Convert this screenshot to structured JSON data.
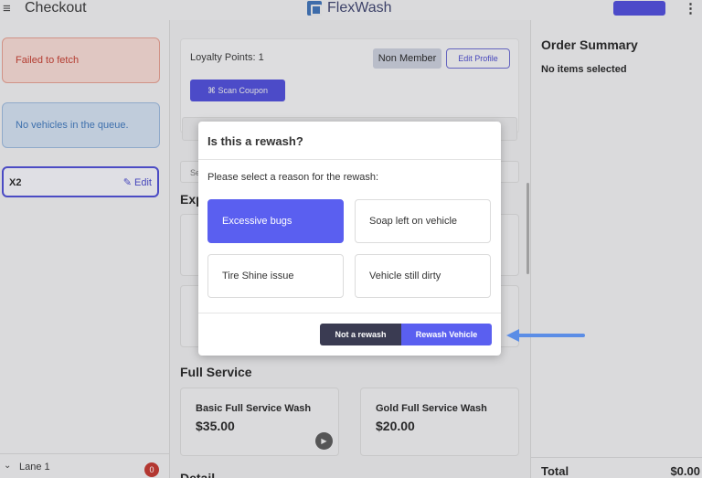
{
  "header": {
    "title": "Checkout",
    "brand": "FlexWash",
    "menu_glyph": "≡",
    "more_glyph": "⋮"
  },
  "left": {
    "error_text": "Failed to fetch",
    "info_text": "No vehicles in the queue.",
    "vehicle_label": "X2",
    "vehicle_edit": "✎ Edit",
    "lane_label": "Lane 1",
    "lane_count": "0"
  },
  "middle": {
    "loyalty_text": "Loyalty Points: 1",
    "member_badge": "Non Member",
    "edit_profile": "Edit Profile",
    "scan_coupon": "⌘  Scan Coupon",
    "search_stub": "Se",
    "section_exp": "Exp",
    "section_full": "Full Service",
    "section_details": "Detail",
    "wash_cards": [
      {
        "name": "Basic Full Service Wash",
        "price": "$35.00"
      },
      {
        "name": "Gold Full Service Wash",
        "price": "$20.00"
      }
    ]
  },
  "right": {
    "order_title": "Order Summary",
    "order_empty": "No items selected",
    "total_label": "Total",
    "total_value": "$0.00"
  },
  "modal": {
    "title": "Is this a rewash?",
    "prompt": "Please select a reason for the rewash:",
    "reasons": [
      {
        "label": "Excessive bugs",
        "selected": true
      },
      {
        "label": "Soap left on vehicle",
        "selected": false
      },
      {
        "label": "Tire Shine issue",
        "selected": false
      },
      {
        "label": "Vehicle still dirty",
        "selected": false
      }
    ],
    "not_rewash_label": "Not a rewash",
    "rewash_label": "Rewash Vehicle"
  },
  "colors": {
    "accent": "#5a5ff0",
    "dark_button": "#3a3b52",
    "annotation_arrow": "#5b8de6"
  },
  "icons": [
    "menu-icon",
    "flexwash-logo-icon",
    "more-vert-icon",
    "pencil-icon",
    "qr-scan-icon",
    "chevron-down-icon",
    "play-icon",
    "arrow-left-icon"
  ]
}
